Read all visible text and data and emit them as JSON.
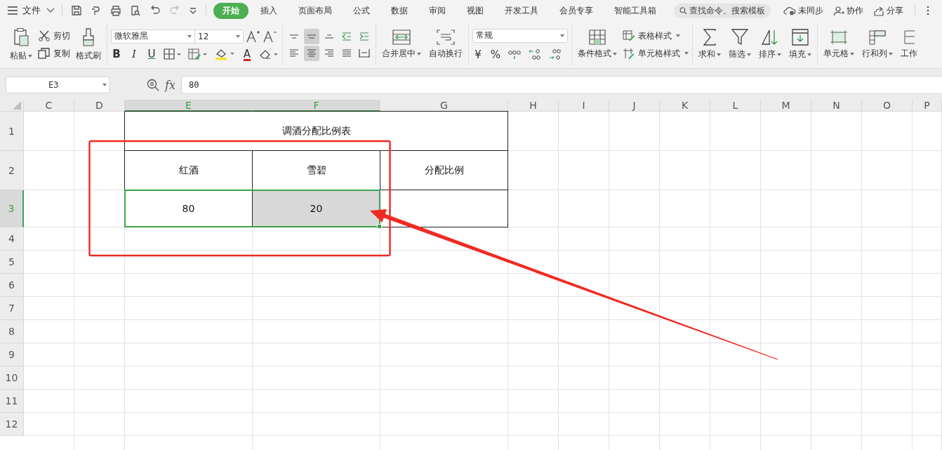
{
  "menu": {
    "file": "文件",
    "tabs": [
      {
        "label": "开始",
        "selected": true
      },
      {
        "label": "插入",
        "selected": false
      },
      {
        "label": "页面布局",
        "selected": false
      },
      {
        "label": "公式",
        "selected": false
      },
      {
        "label": "数据",
        "selected": false
      },
      {
        "label": "审阅",
        "selected": false
      },
      {
        "label": "视图",
        "selected": false
      },
      {
        "label": "开发工具",
        "selected": false
      },
      {
        "label": "会员专享",
        "selected": false
      },
      {
        "label": "智能工具箱",
        "selected": false
      }
    ],
    "search": {
      "placeholder": "查找命令、搜索模板"
    },
    "actions": [
      "未同步",
      "协作",
      "分享"
    ]
  },
  "ribbon": {
    "paste": {
      "label": "粘贴",
      "dropdown": true
    },
    "cut": "剪切",
    "copy": "复制",
    "format_painter": "格式刷",
    "font_name": "微软雅黑",
    "font_size": "12",
    "bold": "B",
    "italic": "I",
    "underline": "U",
    "font_color": "A",
    "vertical_align": [
      {
        "selected": false
      },
      {
        "selected": true
      },
      {
        "selected": false
      },
      {
        "selected": false
      },
      {
        "selected": false
      }
    ],
    "horizontal_align": [
      {
        "selected": false
      },
      {
        "selected": true
      },
      {
        "selected": false
      },
      {
        "selected": false
      },
      {
        "selected": false
      }
    ],
    "merge": {
      "label": "合并居中",
      "dropdown": true
    },
    "wrap": {
      "label": "自动换行",
      "dropdown": false
    },
    "number_format": "常规",
    "currency": "¥",
    "percent": "%",
    "conditional": {
      "label": "条件格式",
      "dropdown": true
    },
    "styles": [
      {
        "label": "表格样式",
        "dropdown": true
      },
      {
        "label": "单元格样式",
        "dropdown": true
      }
    ],
    "tools": [
      {
        "label": "求和",
        "dropdown": true
      },
      {
        "label": "筛选",
        "dropdown": true
      },
      {
        "label": "排序",
        "dropdown": true
      },
      {
        "label": "填充",
        "dropdown": true
      }
    ],
    "cells_tools": [
      {
        "label": "单元格",
        "dropdown": true
      },
      {
        "label": "行和列",
        "dropdown": true
      },
      {
        "label": "工作",
        "dropdown": false
      }
    ]
  },
  "formula_bar": {
    "name_box": "E3",
    "fx": "fx",
    "value": "80"
  },
  "sheet": {
    "columns": [
      {
        "label": "C",
        "selected": false
      },
      {
        "label": "D",
        "selected": false
      },
      {
        "label": "E",
        "selected": true
      },
      {
        "label": "F",
        "selected": true
      },
      {
        "label": "G",
        "selected": false
      },
      {
        "label": "H",
        "selected": false
      },
      {
        "label": "I",
        "selected": false
      },
      {
        "label": "J",
        "selected": false
      },
      {
        "label": "K",
        "selected": false
      },
      {
        "label": "L",
        "selected": false
      },
      {
        "label": "M",
        "selected": false
      },
      {
        "label": "N",
        "selected": false
      },
      {
        "label": "O",
        "selected": false
      },
      {
        "label": "P",
        "selected": false
      }
    ],
    "rows": [
      {
        "label": "1",
        "selected": false
      },
      {
        "label": "2",
        "selected": false
      },
      {
        "label": "3",
        "selected": true
      },
      {
        "label": "4",
        "selected": false
      },
      {
        "label": "5",
        "selected": false
      },
      {
        "label": "6",
        "selected": false
      },
      {
        "label": "7",
        "selected": false
      },
      {
        "label": "8",
        "selected": false
      },
      {
        "label": "9",
        "selected": false
      },
      {
        "label": "10",
        "selected": false
      },
      {
        "label": "11",
        "selected": false
      },
      {
        "label": "12",
        "selected": false
      }
    ],
    "table": {
      "title": {
        "text": "调酒分配比例表",
        "selected": false
      },
      "rows": [
        [
          {
            "text": "红酒",
            "selected": false
          },
          {
            "text": "雪碧",
            "selected": false
          },
          {
            "text": "分配比例",
            "selected": false
          }
        ],
        [
          {
            "text": "80",
            "selected": true
          },
          {
            "text": "20",
            "selected": true
          },
          {
            "selected": false
          }
        ]
      ]
    }
  }
}
